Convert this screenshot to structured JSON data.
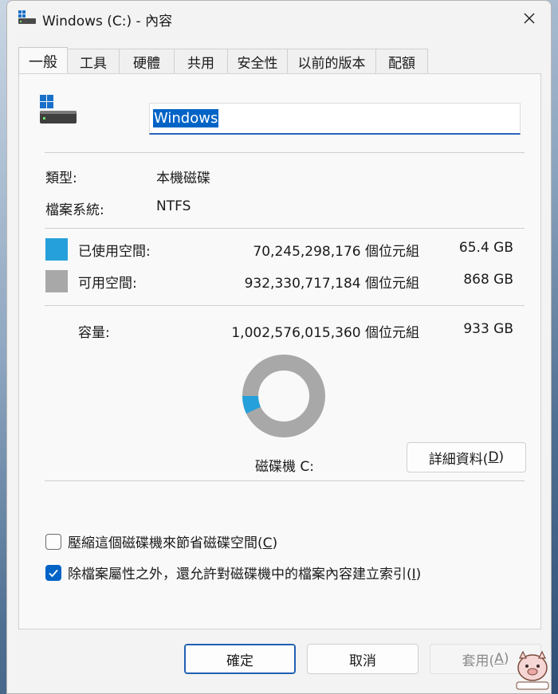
{
  "window": {
    "title": "Windows (C:) - 內容"
  },
  "tabs": [
    {
      "label": "一般",
      "active": true
    },
    {
      "label": "工具"
    },
    {
      "label": "硬體"
    },
    {
      "label": "共用"
    },
    {
      "label": "安全性"
    },
    {
      "label": "以前的版本"
    },
    {
      "label": "配額"
    }
  ],
  "drive": {
    "name": "Windows",
    "type_label": "類型:",
    "type_value": "本機磁碟",
    "fs_label": "檔案系統:",
    "fs_value": "NTFS"
  },
  "space": {
    "used_label": "已使用空間:",
    "used_bytes": "70,245,298,176 個位元組",
    "used_size": "65.4 GB",
    "free_label": "可用空間:",
    "free_bytes": "932,330,717,184 個位元組",
    "free_size": "868 GB",
    "capacity_label": "容量:",
    "capacity_bytes": "1,002,576,015,360 個位元組",
    "capacity_size": "933 GB",
    "used_fraction": 0.07,
    "used_color": "#26a0da",
    "free_color": "#a8a8a8"
  },
  "disk_label": "磁碟機 C:",
  "details_button": {
    "label": "詳細資料(",
    "key": "D",
    "suffix": ")"
  },
  "options": {
    "compress": {
      "label": "壓縮這個磁碟機來節省磁碟空間(",
      "key": "C",
      "suffix": ")",
      "checked": false
    },
    "index": {
      "label": "除檔案屬性之外，還允許對磁碟機中的檔案內容建立索引(",
      "key": "I",
      "suffix": ")",
      "checked": true
    }
  },
  "buttons": {
    "ok": "確定",
    "cancel": "取消",
    "apply": "套用(",
    "apply_key": "A",
    "apply_suffix": ")"
  }
}
